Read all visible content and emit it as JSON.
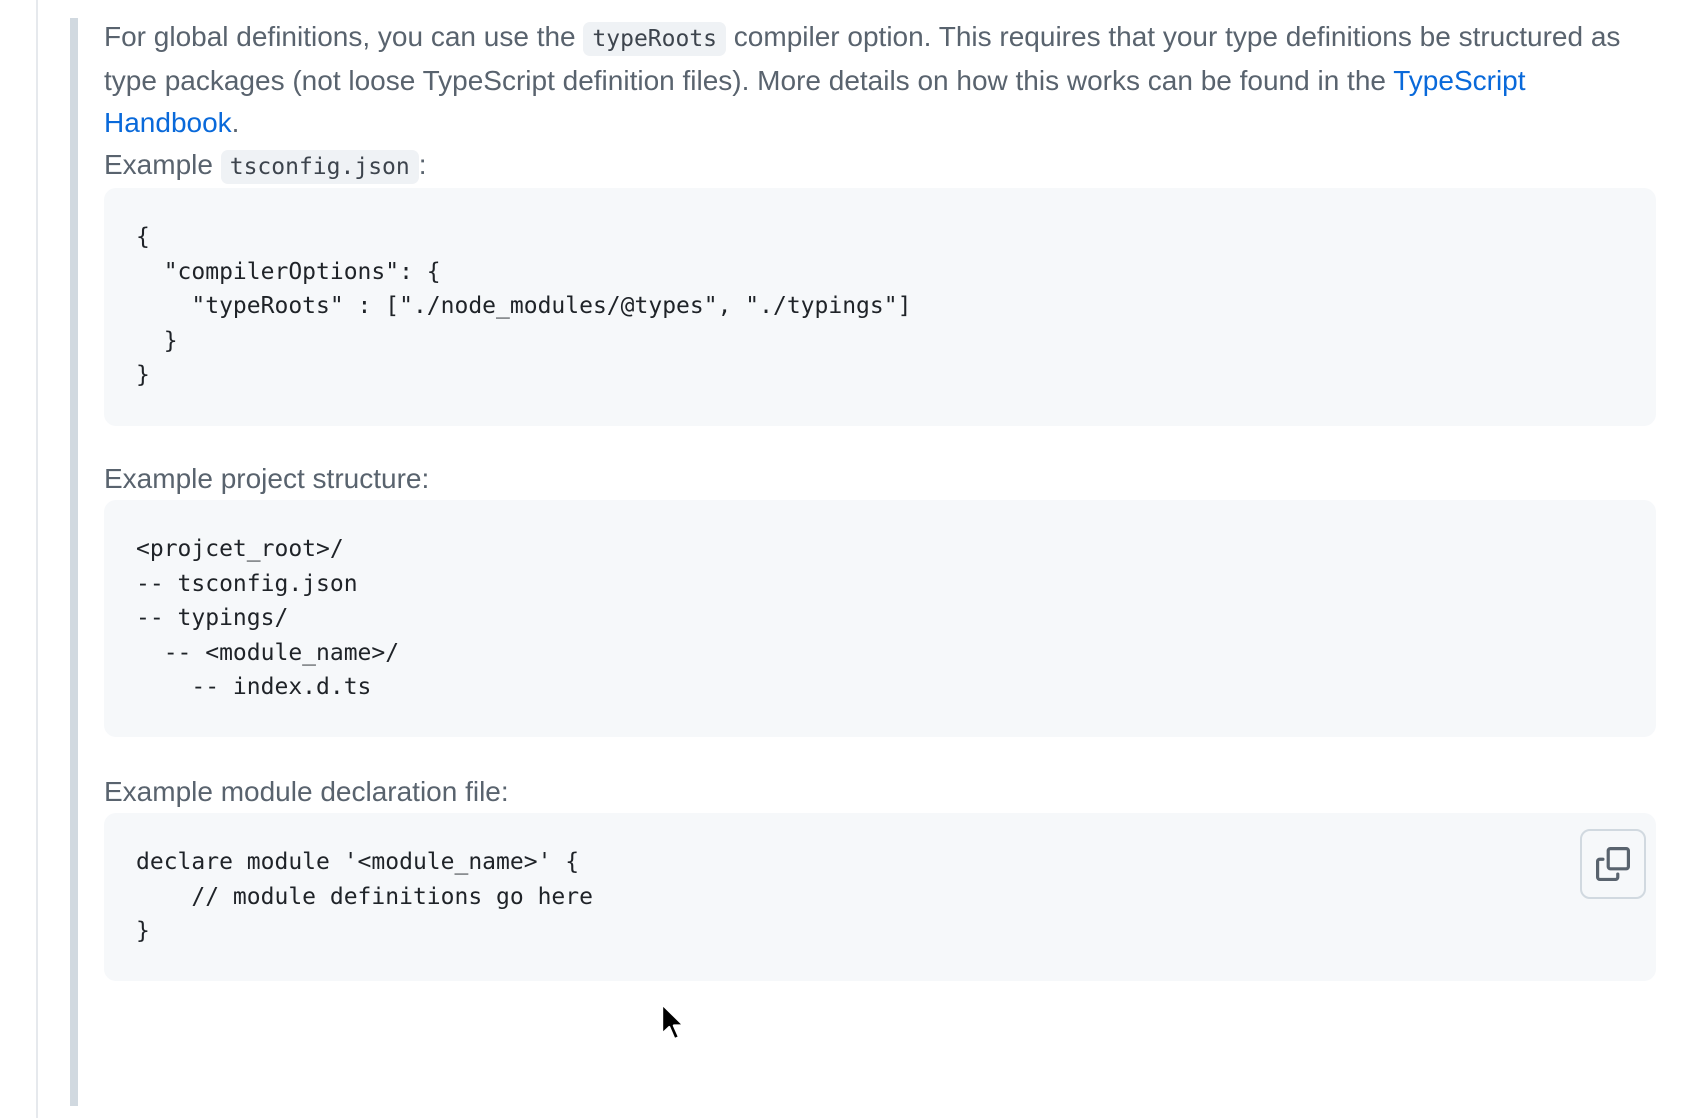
{
  "intro": {
    "text_before_code": "For global definitions, you can use the ",
    "inline_code": "typeRoots",
    "text_after_code": " compiler option. This requires that your type definitions be structured as type packages (not loose TypeScript definition files). More details on how this works can be found in the ",
    "link_text": "TypeScript Handbook",
    "text_end": "."
  },
  "example_tsconfig": {
    "label": "Example ",
    "inline_code": "tsconfig.json",
    "suffix": ":"
  },
  "code_blocks": {
    "tsconfig": "{\n  \"compilerOptions\": {\n    \"typeRoots\" : [\"./node_modules/@types\", \"./typings\"]\n  }\n}",
    "project_structure": "<projcet_root>/\n-- tsconfig.json\n-- typings/\n  -- <module_name>/\n    -- index.d.ts",
    "module_declaration": "declare module '<module_name>' {\n    // module definitions go here\n}"
  },
  "labels": {
    "project_structure": "Example project structure:",
    "module_declaration": "Example module declaration file:"
  },
  "icons": {
    "copy": "copy-icon",
    "cursor": "mouse-pointer-icon"
  },
  "colors": {
    "link": "#0969da",
    "code_background": "#f6f8fa",
    "quote_bar": "#d1d9e0",
    "body_text": "#59636e"
  }
}
